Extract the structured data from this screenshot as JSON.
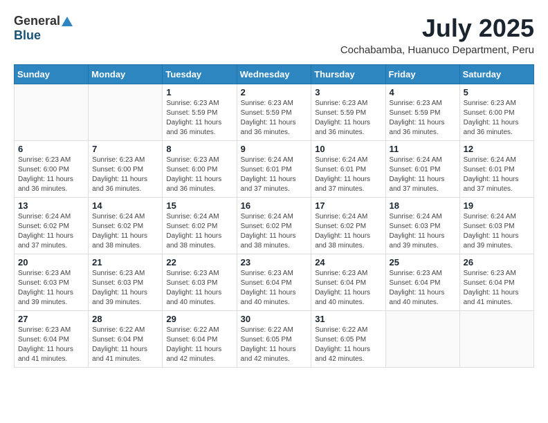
{
  "logo": {
    "general": "General",
    "blue": "Blue"
  },
  "title": "July 2025",
  "location": "Cochabamba, Huanuco Department, Peru",
  "weekdays": [
    "Sunday",
    "Monday",
    "Tuesday",
    "Wednesday",
    "Thursday",
    "Friday",
    "Saturday"
  ],
  "weeks": [
    [
      {
        "day": "",
        "info": ""
      },
      {
        "day": "",
        "info": ""
      },
      {
        "day": "1",
        "info": "Sunrise: 6:23 AM\nSunset: 5:59 PM\nDaylight: 11 hours and 36 minutes."
      },
      {
        "day": "2",
        "info": "Sunrise: 6:23 AM\nSunset: 5:59 PM\nDaylight: 11 hours and 36 minutes."
      },
      {
        "day": "3",
        "info": "Sunrise: 6:23 AM\nSunset: 5:59 PM\nDaylight: 11 hours and 36 minutes."
      },
      {
        "day": "4",
        "info": "Sunrise: 6:23 AM\nSunset: 5:59 PM\nDaylight: 11 hours and 36 minutes."
      },
      {
        "day": "5",
        "info": "Sunrise: 6:23 AM\nSunset: 6:00 PM\nDaylight: 11 hours and 36 minutes."
      }
    ],
    [
      {
        "day": "6",
        "info": "Sunrise: 6:23 AM\nSunset: 6:00 PM\nDaylight: 11 hours and 36 minutes."
      },
      {
        "day": "7",
        "info": "Sunrise: 6:23 AM\nSunset: 6:00 PM\nDaylight: 11 hours and 36 minutes."
      },
      {
        "day": "8",
        "info": "Sunrise: 6:23 AM\nSunset: 6:00 PM\nDaylight: 11 hours and 36 minutes."
      },
      {
        "day": "9",
        "info": "Sunrise: 6:24 AM\nSunset: 6:01 PM\nDaylight: 11 hours and 37 minutes."
      },
      {
        "day": "10",
        "info": "Sunrise: 6:24 AM\nSunset: 6:01 PM\nDaylight: 11 hours and 37 minutes."
      },
      {
        "day": "11",
        "info": "Sunrise: 6:24 AM\nSunset: 6:01 PM\nDaylight: 11 hours and 37 minutes."
      },
      {
        "day": "12",
        "info": "Sunrise: 6:24 AM\nSunset: 6:01 PM\nDaylight: 11 hours and 37 minutes."
      }
    ],
    [
      {
        "day": "13",
        "info": "Sunrise: 6:24 AM\nSunset: 6:02 PM\nDaylight: 11 hours and 37 minutes."
      },
      {
        "day": "14",
        "info": "Sunrise: 6:24 AM\nSunset: 6:02 PM\nDaylight: 11 hours and 38 minutes."
      },
      {
        "day": "15",
        "info": "Sunrise: 6:24 AM\nSunset: 6:02 PM\nDaylight: 11 hours and 38 minutes."
      },
      {
        "day": "16",
        "info": "Sunrise: 6:24 AM\nSunset: 6:02 PM\nDaylight: 11 hours and 38 minutes."
      },
      {
        "day": "17",
        "info": "Sunrise: 6:24 AM\nSunset: 6:02 PM\nDaylight: 11 hours and 38 minutes."
      },
      {
        "day": "18",
        "info": "Sunrise: 6:24 AM\nSunset: 6:03 PM\nDaylight: 11 hours and 39 minutes."
      },
      {
        "day": "19",
        "info": "Sunrise: 6:24 AM\nSunset: 6:03 PM\nDaylight: 11 hours and 39 minutes."
      }
    ],
    [
      {
        "day": "20",
        "info": "Sunrise: 6:23 AM\nSunset: 6:03 PM\nDaylight: 11 hours and 39 minutes."
      },
      {
        "day": "21",
        "info": "Sunrise: 6:23 AM\nSunset: 6:03 PM\nDaylight: 11 hours and 39 minutes."
      },
      {
        "day": "22",
        "info": "Sunrise: 6:23 AM\nSunset: 6:03 PM\nDaylight: 11 hours and 40 minutes."
      },
      {
        "day": "23",
        "info": "Sunrise: 6:23 AM\nSunset: 6:04 PM\nDaylight: 11 hours and 40 minutes."
      },
      {
        "day": "24",
        "info": "Sunrise: 6:23 AM\nSunset: 6:04 PM\nDaylight: 11 hours and 40 minutes."
      },
      {
        "day": "25",
        "info": "Sunrise: 6:23 AM\nSunset: 6:04 PM\nDaylight: 11 hours and 40 minutes."
      },
      {
        "day": "26",
        "info": "Sunrise: 6:23 AM\nSunset: 6:04 PM\nDaylight: 11 hours and 41 minutes."
      }
    ],
    [
      {
        "day": "27",
        "info": "Sunrise: 6:23 AM\nSunset: 6:04 PM\nDaylight: 11 hours and 41 minutes."
      },
      {
        "day": "28",
        "info": "Sunrise: 6:22 AM\nSunset: 6:04 PM\nDaylight: 11 hours and 41 minutes."
      },
      {
        "day": "29",
        "info": "Sunrise: 6:22 AM\nSunset: 6:04 PM\nDaylight: 11 hours and 42 minutes."
      },
      {
        "day": "30",
        "info": "Sunrise: 6:22 AM\nSunset: 6:05 PM\nDaylight: 11 hours and 42 minutes."
      },
      {
        "day": "31",
        "info": "Sunrise: 6:22 AM\nSunset: 6:05 PM\nDaylight: 11 hours and 42 minutes."
      },
      {
        "day": "",
        "info": ""
      },
      {
        "day": "",
        "info": ""
      }
    ]
  ]
}
